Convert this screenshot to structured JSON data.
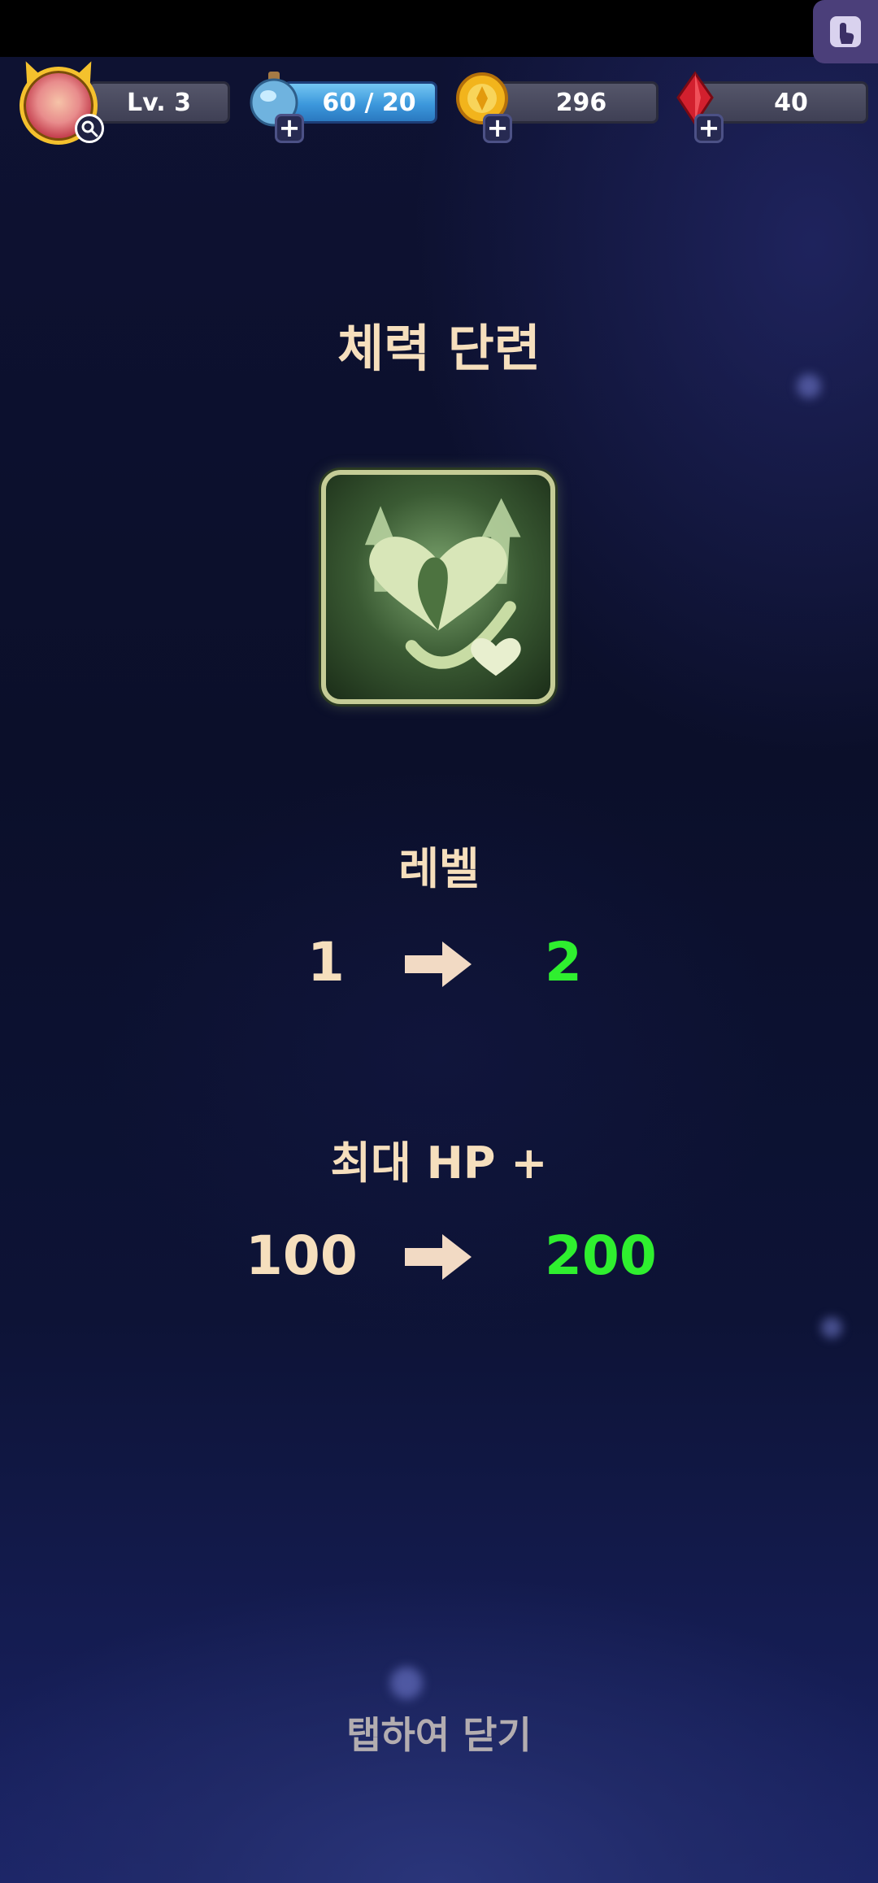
{
  "hud": {
    "level_text": "Lv. 3",
    "energy_text": "60 / 20",
    "gold_text": "296",
    "gem_text": "40",
    "plus_symbol": "+",
    "icons": {
      "avatar": "player-avatar",
      "magnifier": "magnifier-icon",
      "energy": "potion-flask-icon",
      "gold": "gold-coin-icon",
      "gem": "red-gem-icon",
      "corner": "touch-lock-icon"
    }
  },
  "popup": {
    "title": "체력 단련",
    "skill_icon": "heart-growth-icon",
    "level": {
      "label": "레벨",
      "from": "1",
      "to": "2"
    },
    "max_hp": {
      "label": "최대 HP +",
      "from": "100",
      "to": "200"
    },
    "close_hint": "탭하여 닫기"
  },
  "colors": {
    "title_text": "#f6dfbd",
    "new_value": "#2fef2f",
    "hint_text": "#b3adb0",
    "energy_bar": "#3c98dc"
  }
}
